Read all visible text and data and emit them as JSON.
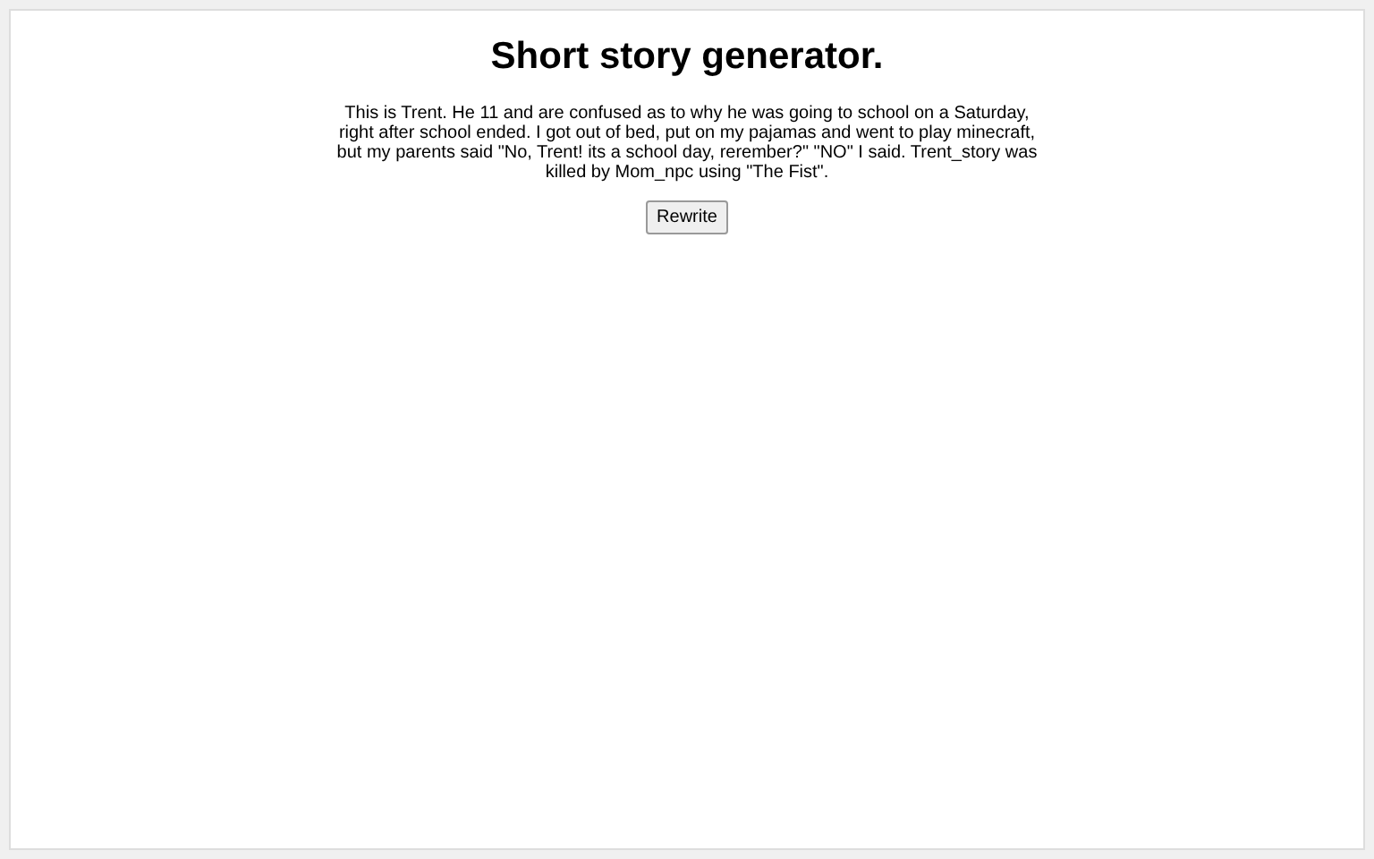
{
  "title": "Short story generator.",
  "story": "This is Trent. He 11 and are confused as to why he was going to school on a Saturday, right after school ended. I got out of bed, put on my pajamas and went to play minecraft, but my parents said \"No, Trent! its a school day, rerember?\" \"NO\" I said. Trent_story was killed by Mom_npc using \"The Fist\".",
  "button": "Rewrite"
}
